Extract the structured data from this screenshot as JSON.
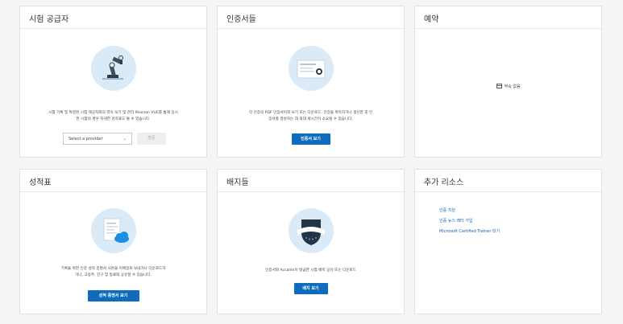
{
  "exam_providers": {
    "title": "시험 공급자",
    "description": "시험 기록 및 특정된 시험 제공자와의 약속 보기 및 관리 Pearson VUE를 통해 응시\n한 시험의 경우 자세한 성적표도 볼 수 있습니다.",
    "select_value": "Select a provider",
    "go_label": "방문"
  },
  "certifications": {
    "title": "인증서들",
    "description": "각 인증의 PDF 인증서이외 보기 또는 다운로드. 인증을 획득하거나 갱신한 후 인\n증서를 생성하는 데 최대 세시간이 소요될 수 있습니다.",
    "button_label": "인증서 보기"
  },
  "appointments": {
    "title": "예약",
    "empty_label": "약속 없음"
  },
  "transcript": {
    "title": "성적표",
    "description": "기록을 위한 인증 성적 증명서 사본을 이메일로 보내거나 다운로드하\n거나, 고용주, 친구 및 동료와 공유할 수 있습니다.",
    "button_label": "성적 증명서 보기"
  },
  "badges": {
    "title": "배지들",
    "description": "인증서와 Accalim이 발급한 시험 배지 공유 또는 다운로드",
    "button_label": "배지 보기"
  },
  "resources": {
    "title": "추가 리소스",
    "links": [
      "인증 지원",
      "인증 뉴스 레터 가입",
      "Microsoft Certified Trainer 되기"
    ]
  },
  "colors": {
    "accent": "#0f6cbd",
    "illustration_bg": "#dbeaf7",
    "link": "#1a64b6"
  }
}
